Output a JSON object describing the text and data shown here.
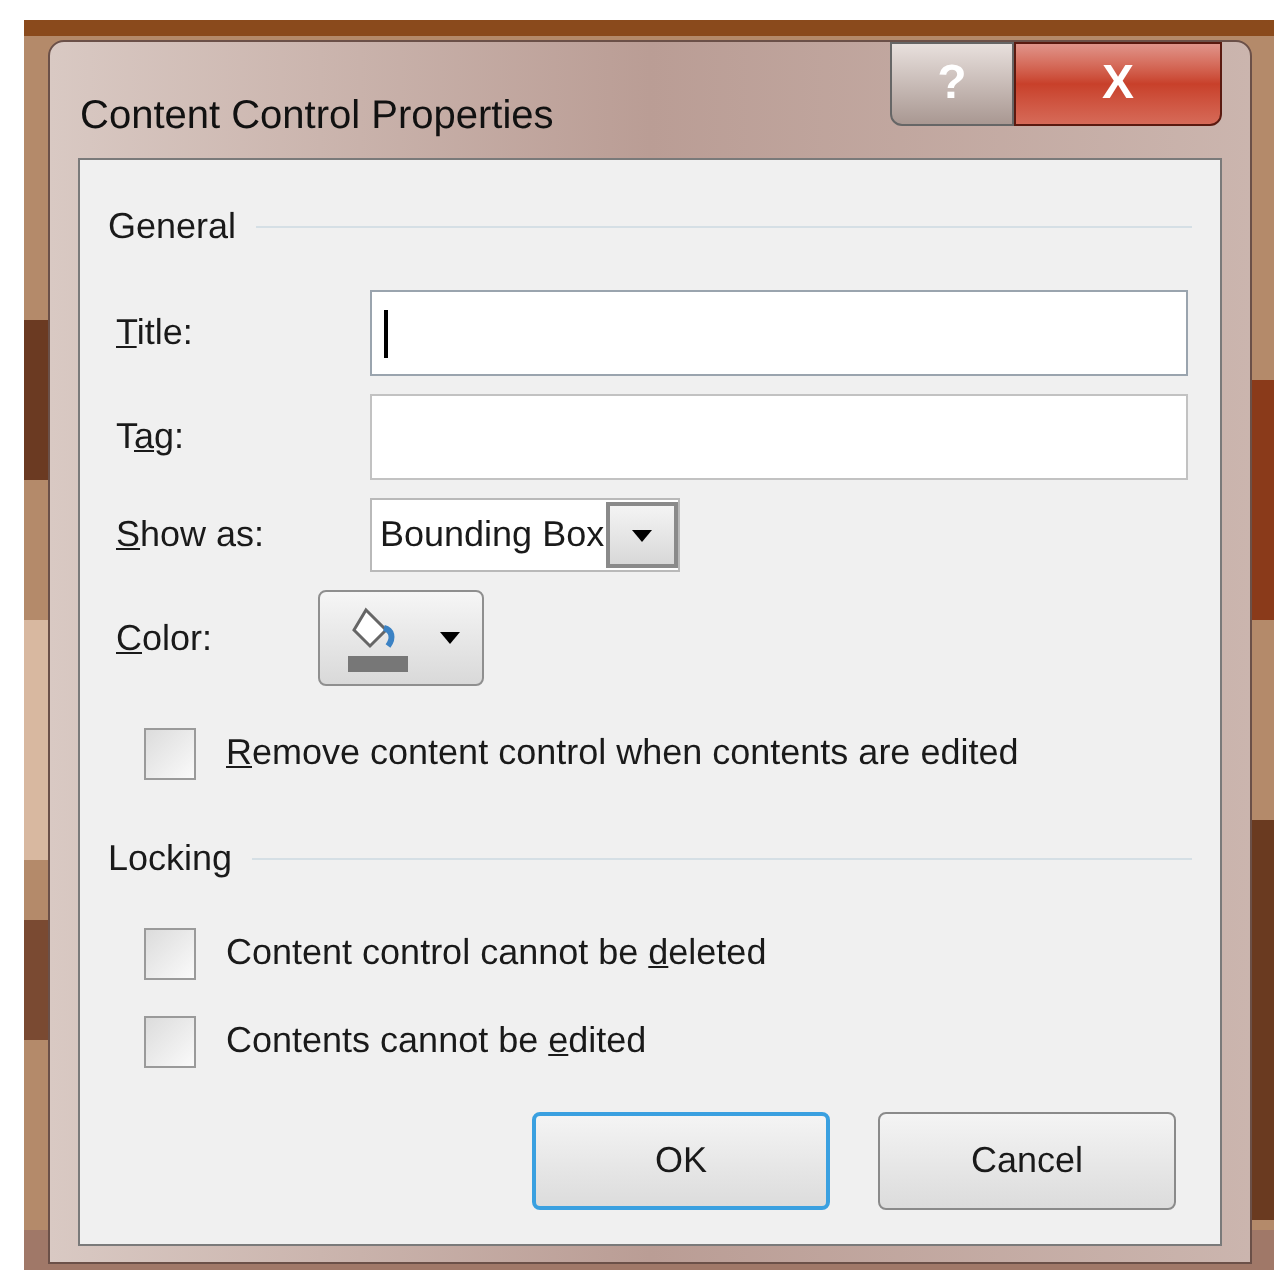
{
  "window": {
    "title": "Content Control Properties",
    "help_button": "?",
    "close_button": "X"
  },
  "general": {
    "heading": "General",
    "fields": [
      {
        "kind": "text",
        "label": {
          "key": "T",
          "post": "itle:"
        },
        "focused": true
      },
      {
        "kind": "text",
        "label": {
          "pre": "T",
          "key": "a",
          "post": "g:"
        },
        "focused": false
      },
      {
        "kind": "select",
        "label": {
          "key": "S",
          "post": "how as:"
        },
        "value": "Bounding Box"
      },
      {
        "kind": "color",
        "label": {
          "key": "C",
          "post": "olor:"
        }
      }
    ],
    "checkboxes": [
      {
        "label": {
          "key": "R",
          "post": "emove content control when contents are edited"
        },
        "checked": false
      }
    ]
  },
  "locking": {
    "heading": "Locking",
    "checkboxes": [
      {
        "label": {
          "pre": "Content control cannot be ",
          "key": "d",
          "post": "eleted"
        },
        "checked": false
      },
      {
        "label": {
          "pre": "Contents cannot be ",
          "key": "e",
          "post": "dited"
        },
        "checked": false
      }
    ]
  },
  "buttons": [
    {
      "label": "OK",
      "default": true
    },
    {
      "label": "Cancel",
      "default": false
    }
  ]
}
